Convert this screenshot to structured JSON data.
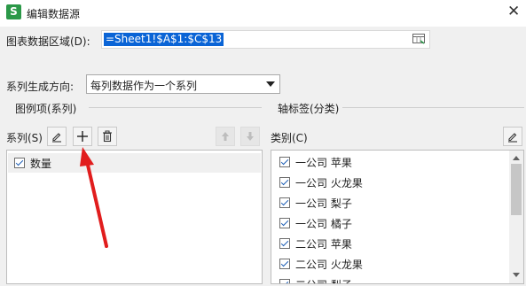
{
  "window": {
    "app_icon_letter": "S",
    "title": "编辑数据源",
    "close_glyph": "✕"
  },
  "chart_range": {
    "label": "图表数据区域(D):",
    "value": "=Sheet1!$A$1:$C$13"
  },
  "series_direction": {
    "label": "系列生成方向:",
    "selected": "每列数据作为一个系列"
  },
  "legend_group": {
    "title": "图例项(系列)",
    "toolbar_label": "系列(S)",
    "items": [
      {
        "label": "数量",
        "checked": true
      }
    ]
  },
  "axis_group": {
    "title": "轴标签(分类)",
    "toolbar_label": "类别(C)",
    "items": [
      {
        "label": "一公司 苹果",
        "checked": true
      },
      {
        "label": "一公司 火龙果",
        "checked": true
      },
      {
        "label": "一公司 梨子",
        "checked": true
      },
      {
        "label": "一公司 橘子",
        "checked": true
      },
      {
        "label": "二公司 苹果",
        "checked": true
      },
      {
        "label": "二公司 火龙果",
        "checked": true
      },
      {
        "label": "二公司 梨子",
        "checked": true
      }
    ]
  },
  "annotation": {
    "color": "#e11d1d"
  },
  "colors": {
    "selection": "#0a64d6",
    "app_icon": "#2b9848",
    "check": "#1e5fb5"
  }
}
